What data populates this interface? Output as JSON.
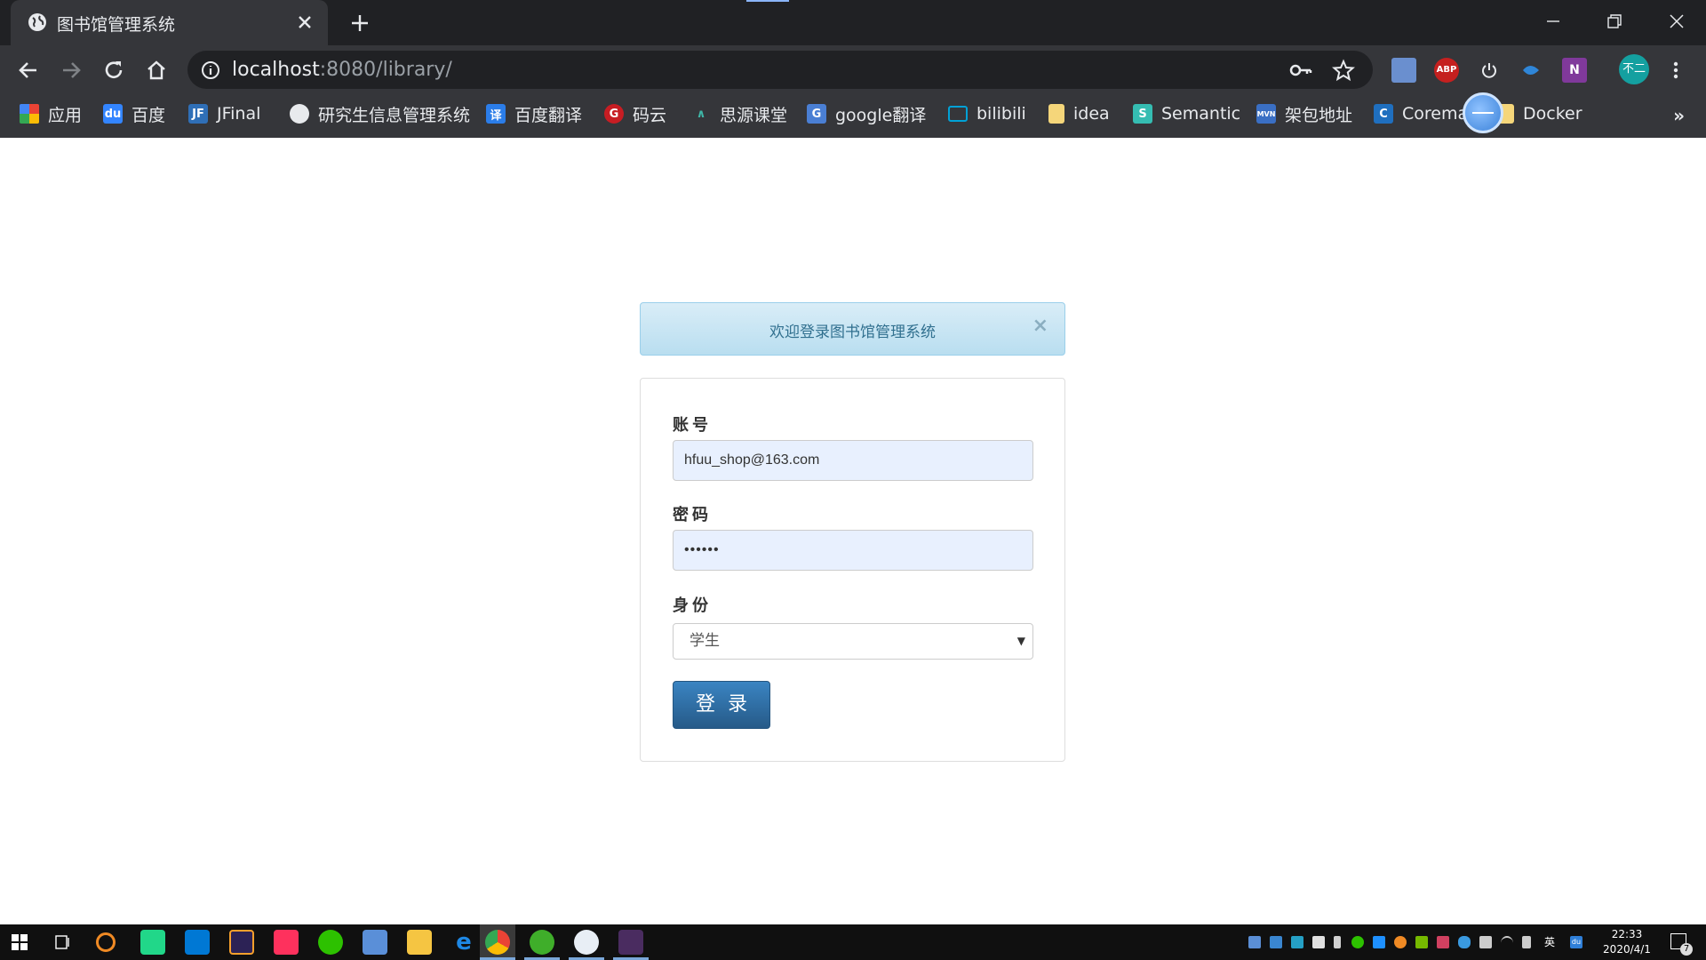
{
  "browser": {
    "tab_title": "图书馆管理系统",
    "url_host": "localhost",
    "url_rest": ":8080/library/",
    "profile_initials": "不二",
    "bookmarks": [
      {
        "label": "应用",
        "icon": "apps-grid-icon"
      },
      {
        "label": "百度",
        "icon": "baidu-icon"
      },
      {
        "label": "JFinal",
        "icon": "jfinal-icon"
      },
      {
        "label": "研究生信息管理系统",
        "icon": "globe-icon"
      },
      {
        "label": "百度翻译",
        "icon": "translate-icon"
      },
      {
        "label": "码云",
        "icon": "gitee-icon"
      },
      {
        "label": "思源课堂",
        "icon": "siyuan-icon"
      },
      {
        "label": "google翻译",
        "icon": "google-translate-icon"
      },
      {
        "label": "bilibili",
        "icon": "bilibili-icon"
      },
      {
        "label": "idea",
        "icon": "folder-icon"
      },
      {
        "label": "Semantic",
        "icon": "semantic-icon"
      },
      {
        "label": "架包地址",
        "icon": "maven-icon"
      },
      {
        "label": "Corema",
        "icon": "coremail-icon"
      },
      {
        "label": "Docker",
        "icon": "folder-icon"
      }
    ],
    "extensions": [
      "edit-ext-icon",
      "ABP",
      "power-icon",
      "fish-ext-icon",
      "onenote-icon"
    ]
  },
  "alert": {
    "message": "欢迎登录图书馆管理系统",
    "close": "×"
  },
  "form": {
    "account_label": "账号",
    "account_value": "hfuu_shop@163.com",
    "password_label": "密码",
    "password_value": "••••••",
    "role_label": "身份",
    "role_value": "学生",
    "submit_label": "登录"
  },
  "taskbar": {
    "time": "22:33",
    "date": "2020/4/1",
    "ime": "英",
    "notification_count": "7"
  },
  "colors": {
    "alert_bg": "#d9edf7",
    "alert_text": "#31708f",
    "button": "#2e6da4",
    "input_autofill": "#e8f0fe"
  }
}
